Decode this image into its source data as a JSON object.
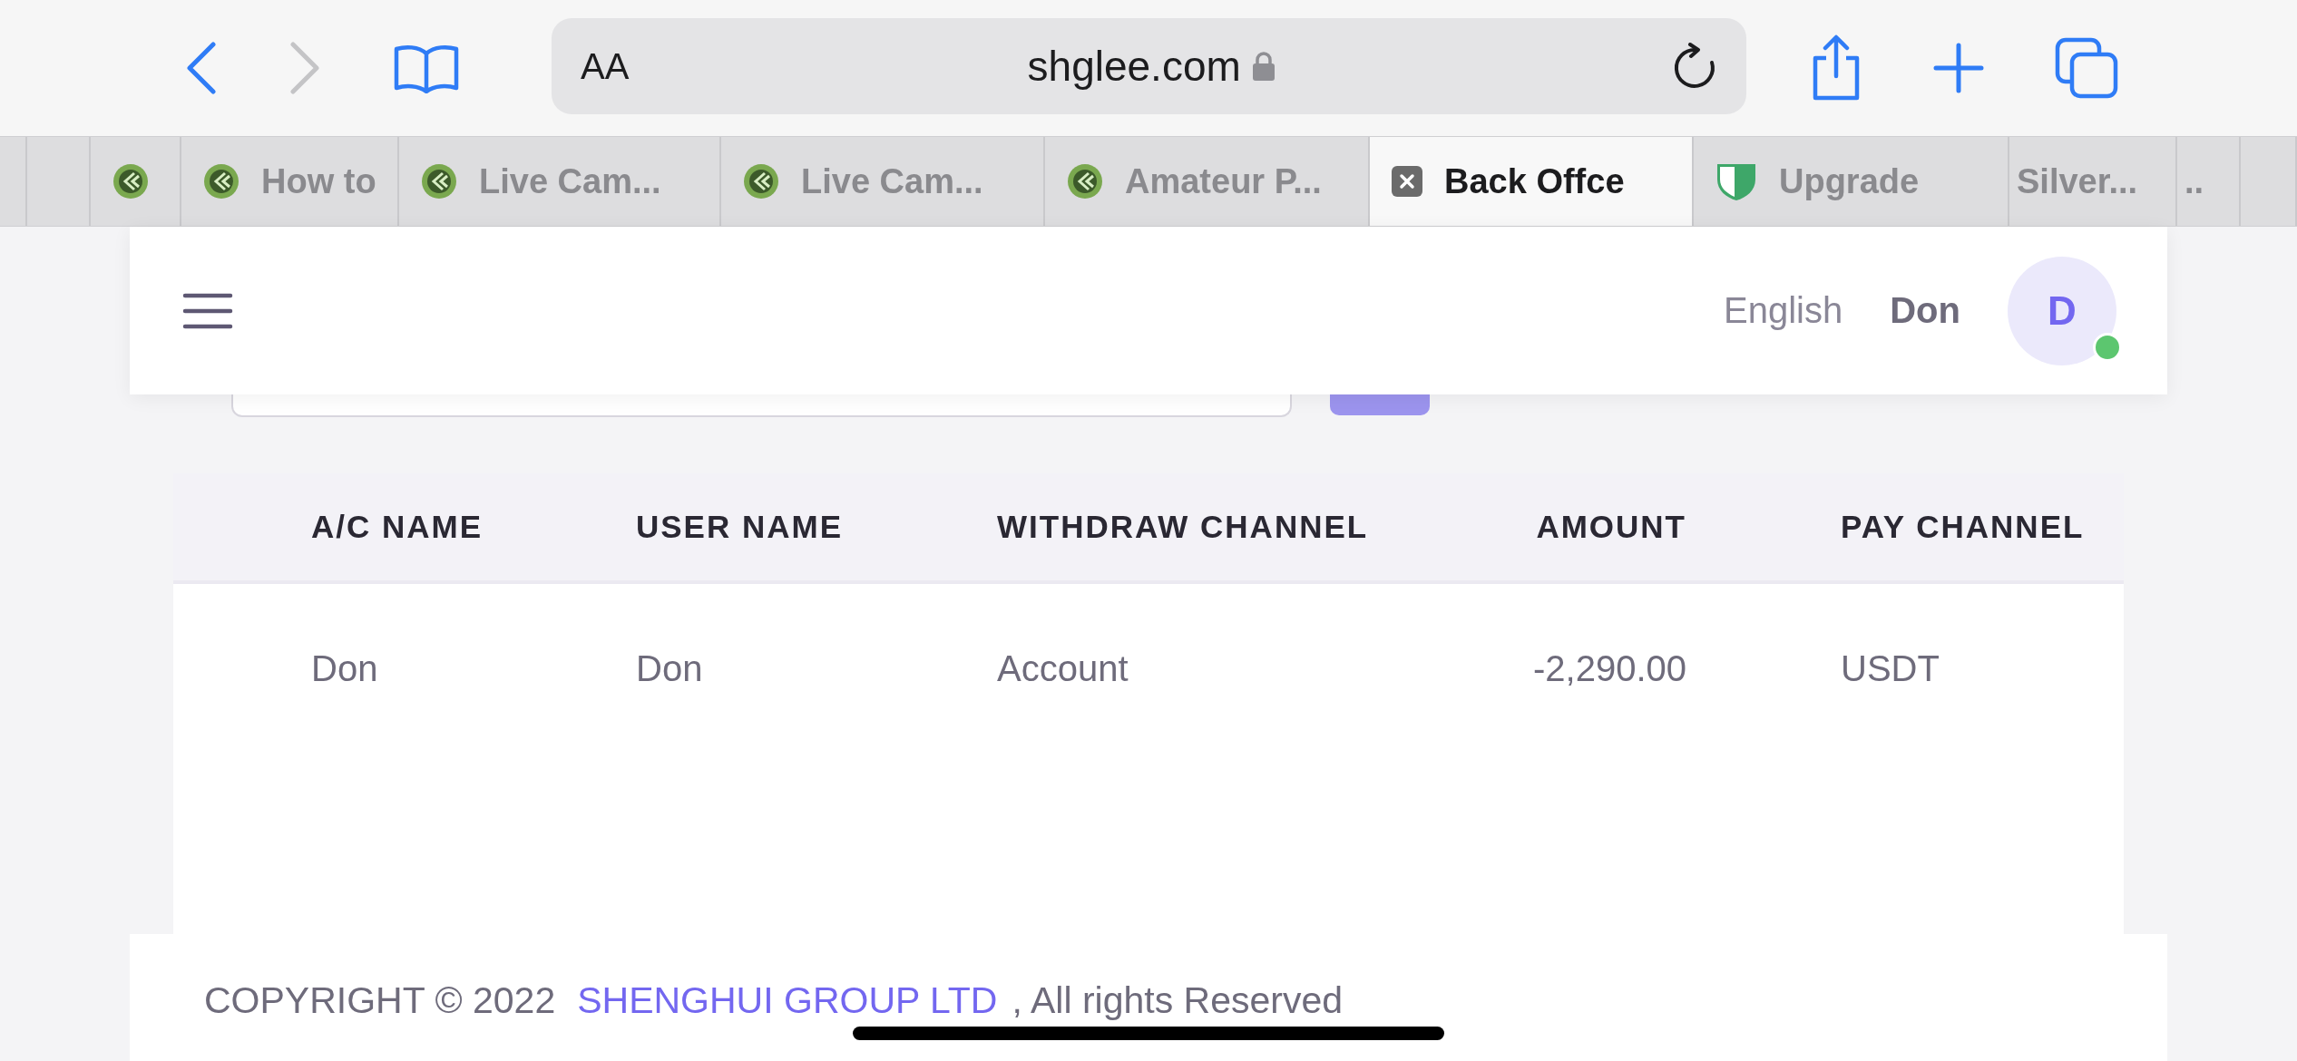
{
  "browser": {
    "back": {
      "disabled": false
    },
    "forward": {
      "disabled": true
    },
    "text_size": "AA",
    "url": "shglee.com",
    "tabs": [
      {
        "kind": "blank",
        "selected": false
      },
      {
        "kind": "blank",
        "selected": false
      },
      {
        "kind": "site",
        "selected": false
      },
      {
        "label": "How to",
        "kind": "site",
        "selected": false
      },
      {
        "label": "Live Cam...",
        "kind": "site",
        "selected": false
      },
      {
        "label": "Live Cam...",
        "kind": "site",
        "selected": false
      },
      {
        "label": "Amateur P...",
        "kind": "site",
        "selected": false
      },
      {
        "label": "Back Offce",
        "kind": "close",
        "selected": true
      },
      {
        "label": "Upgrade",
        "kind": "shield",
        "selected": false
      },
      {
        "label": "Silver...",
        "kind": "blank",
        "selected": false
      },
      {
        "label": "..",
        "kind": "blank",
        "selected": false
      },
      {
        "kind": "blank",
        "selected": false
      }
    ]
  },
  "header": {
    "language": "English",
    "user_name": "Don",
    "avatar_initial": "D",
    "online": true
  },
  "table": {
    "columns": [
      "A/C NAME",
      "USER NAME",
      "WITHDRAW CHANNEL",
      "AMOUNT",
      "PAY CHANNEL"
    ],
    "rows": [
      [
        "Don",
        "Don",
        "Account",
        "-2,290.00",
        "USDT"
      ]
    ]
  },
  "footer": {
    "prefix": "COPYRIGHT © 2022",
    "company": "SHENGHUI GROUP LTD",
    "suffix": ", All rights Reserved"
  }
}
